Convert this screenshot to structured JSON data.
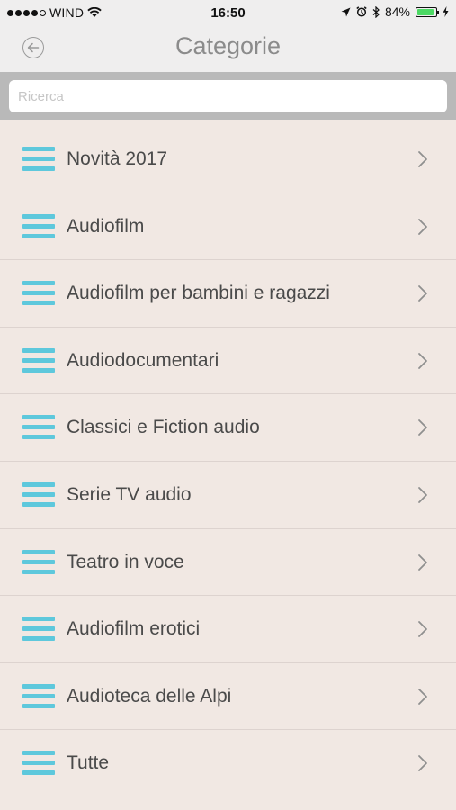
{
  "status_bar": {
    "carrier": "WIND",
    "time": "16:50",
    "battery_percent": "84%",
    "battery_level": 0.84,
    "battery_color": "#4cd964"
  },
  "nav": {
    "title": "Categorie",
    "back_icon": "back-arrow-icon"
  },
  "search": {
    "placeholder": "Ricerca",
    "value": ""
  },
  "categories": [
    {
      "label": "Novità 2017"
    },
    {
      "label": "Audiofilm"
    },
    {
      "label": "Audiofilm per bambini e ragazzi"
    },
    {
      "label": "Audiodocumentari"
    },
    {
      "label": "Classici e Fiction audio"
    },
    {
      "label": "Serie TV audio"
    },
    {
      "label": "Teatro in voce"
    },
    {
      "label": "Audiofilm erotici"
    },
    {
      "label": "Audioteca delle Alpi"
    },
    {
      "label": "Tutte"
    }
  ],
  "colors": {
    "accent": "#5ec8dc",
    "list_background": "#f1e8e3",
    "nav_title": "#8b8b8b"
  }
}
